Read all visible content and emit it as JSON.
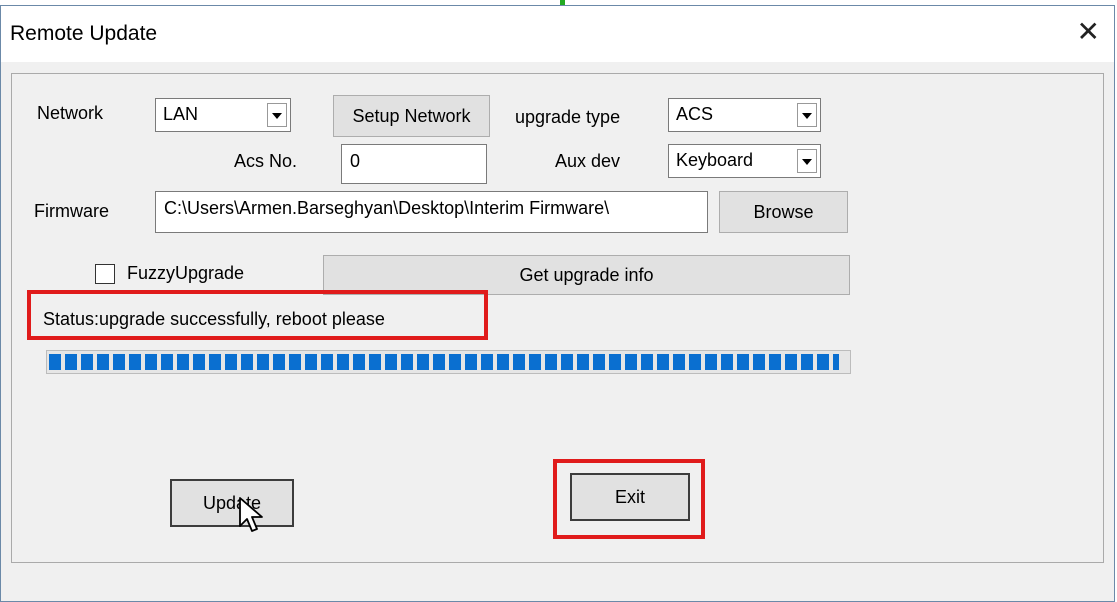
{
  "window": {
    "title": "Remote Update",
    "close_glyph": "✕"
  },
  "form": {
    "network_label": "Network",
    "network_value": "LAN",
    "setup_network_label": "Setup Network",
    "upgrade_type_label": "upgrade type",
    "upgrade_type_value": "ACS",
    "acs_no_label": "Acs No.",
    "acs_no_value": "0",
    "aux_dev_label": "Aux dev",
    "aux_dev_value": "Keyboard",
    "firmware_label": "Firmware",
    "firmware_path": "C:\\Users\\Armen.Barseghyan\\Desktop\\Interim Firmware\\",
    "browse_label": "Browse",
    "fuzzy_upgrade_label": "FuzzyUpgrade",
    "fuzzy_upgrade_checked": false,
    "get_upgrade_info_label": "Get upgrade info"
  },
  "status": {
    "text": "Status:upgrade successfully, reboot please"
  },
  "progress": {
    "value_percent": 100,
    "color": "#0a6fd0"
  },
  "buttons": {
    "update_label": "Update",
    "exit_label": "Exit"
  },
  "highlight_color": "#e01b1b",
  "icons": {
    "cursor": "mouse-pointer-icon",
    "close": "close-icon",
    "dropdown": "chevron-down-icon"
  }
}
